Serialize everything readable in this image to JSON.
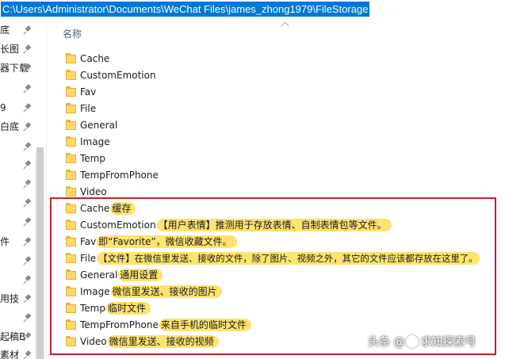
{
  "address_bar": {
    "path": "C:\\Users\\Administrator\\Documents\\WeChat Files\\james_zhong1979\\FileStorage"
  },
  "nav_pane": {
    "items": [
      "底",
      "长图",
      "器下载",
      "",
      "9",
      "白底",
      "",
      "",
      "",
      "",
      "",
      "",
      "件",
      "",
      "",
      "用技",
      "",
      "起稿B",
      "素材"
    ]
  },
  "file_list": {
    "column_name": "名称",
    "folders": [
      "Cache",
      "CustomEmotion",
      "Fav",
      "File",
      "General",
      "Image",
      "Temp",
      "TempFromPhone",
      "Video"
    ],
    "annotated_folders": [
      {
        "name": "Cache",
        "note": "缓存"
      },
      {
        "name": "CustomEmotion",
        "note": "【用户表情】推测用于存放表情、自制表情包等文件。"
      },
      {
        "name": "Fav",
        "note": "即“Favorite”，微信收藏文件。"
      },
      {
        "name": "File",
        "note": "【文件】在微信里发送、接收的文件，除了图片、视频之外，其它的文件应该都存放在这里了。"
      },
      {
        "name": "General",
        "note": "通用设置"
      },
      {
        "name": "Image",
        "note": "微信里发送、接收的图片"
      },
      {
        "name": "Temp",
        "note": "临时文件"
      },
      {
        "name": "TempFromPhone",
        "note": "来自手机的临时文件"
      },
      {
        "name": "Video",
        "note": "微信里发送、接收的视频"
      }
    ]
  },
  "watermark": {
    "prefix": "头条",
    "at": "@",
    "handle": "求知探索号"
  },
  "colors": {
    "selection": "#0078d7",
    "highlight": "#fde36f",
    "folder": "#ffd76b",
    "callout_border": "#c8212a"
  }
}
